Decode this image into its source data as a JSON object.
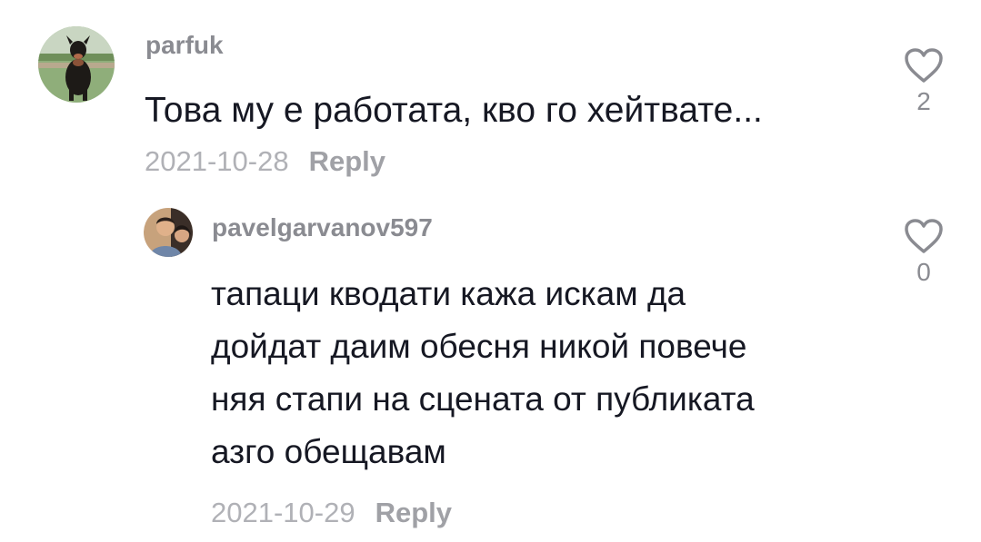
{
  "comments": [
    {
      "username": "parfuk",
      "text_lines": [
        "Това му е работата, кво го хейтвате..."
      ],
      "date": "2021-10-28",
      "reply_label": "Reply",
      "like_icon": "heart-outline-icon",
      "likes": "2",
      "avatar": "dog-photo-avatar"
    },
    {
      "username": "pavelgarvanov597",
      "text_lines": [
        "тапаци кводати кажа искам да",
        "дойдат даим обесня никой повече",
        "няя стапи на сцената от публиката",
        "азго обещавам"
      ],
      "date": "2021-10-29",
      "reply_label": "Reply",
      "like_icon": "heart-outline-icon",
      "likes": "0",
      "avatar": "person-photo-avatar"
    }
  ],
  "colors": {
    "username": "#8a8b91",
    "text": "#161823",
    "date": "#b0b1b6",
    "reply": "#a0a1a6",
    "heart": "#8a8b91"
  }
}
